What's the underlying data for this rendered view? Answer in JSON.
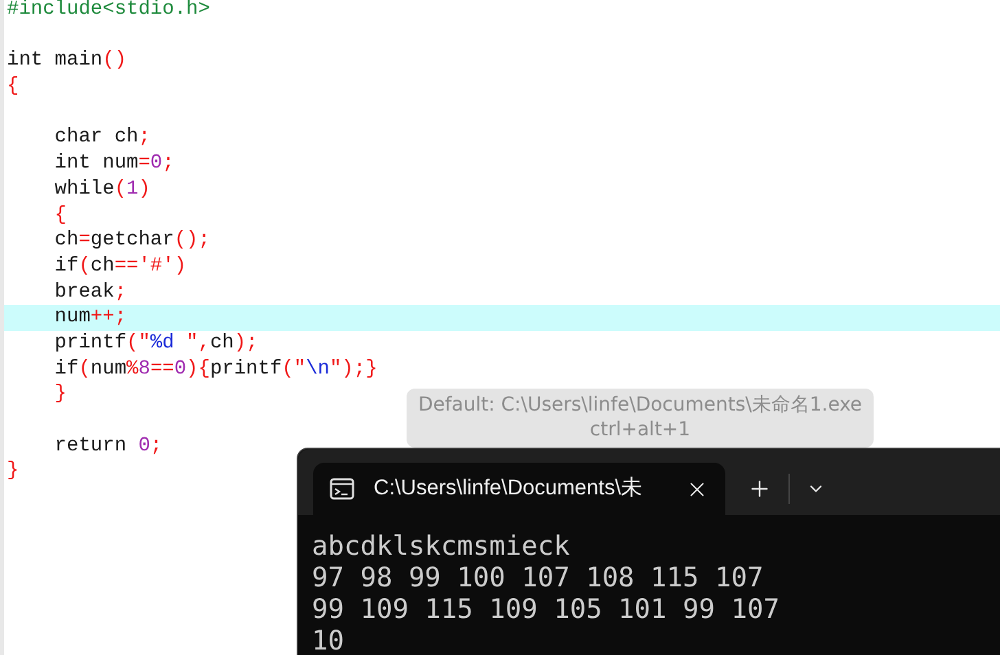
{
  "editor": {
    "lines": [
      {
        "highlighted": false,
        "tokens": [
          {
            "text": "#include<stdio.h>",
            "kind": "preproc"
          }
        ]
      },
      {
        "highlighted": false
      },
      {
        "highlighted": false,
        "tokens": [
          {
            "text": "int main",
            "kind": "plain"
          },
          {
            "text": "()",
            "kind": "punct"
          }
        ]
      },
      {
        "highlighted": false,
        "tokens": [
          {
            "text": "{",
            "kind": "punct"
          }
        ]
      },
      {
        "highlighted": false
      },
      {
        "highlighted": false,
        "tokens": [
          {
            "text": "    char ch",
            "kind": "plain"
          },
          {
            "text": ";",
            "kind": "punct"
          }
        ]
      },
      {
        "highlighted": false,
        "tokens": [
          {
            "text": "    int num",
            "kind": "plain"
          },
          {
            "text": "=",
            "kind": "punct"
          },
          {
            "text": "0",
            "kind": "number"
          },
          {
            "text": ";",
            "kind": "punct"
          }
        ]
      },
      {
        "highlighted": false,
        "tokens": [
          {
            "text": "    while",
            "kind": "plain"
          },
          {
            "text": "(",
            "kind": "punct"
          },
          {
            "text": "1",
            "kind": "number"
          },
          {
            "text": ")",
            "kind": "punct"
          }
        ]
      },
      {
        "highlighted": false,
        "tokens": [
          {
            "text": "    {",
            "kind": "punct"
          }
        ]
      },
      {
        "highlighted": false,
        "tokens": [
          {
            "text": "    ch",
            "kind": "plain"
          },
          {
            "text": "=",
            "kind": "punct"
          },
          {
            "text": "getchar",
            "kind": "plain"
          },
          {
            "text": "();",
            "kind": "punct"
          }
        ]
      },
      {
        "highlighted": false,
        "tokens": [
          {
            "text": "    if",
            "kind": "plain"
          },
          {
            "text": "(",
            "kind": "punct"
          },
          {
            "text": "ch",
            "kind": "plain"
          },
          {
            "text": "=='#')",
            "kind": "punct"
          }
        ]
      },
      {
        "highlighted": false,
        "tokens": [
          {
            "text": "    break",
            "kind": "plain"
          },
          {
            "text": ";",
            "kind": "punct"
          }
        ]
      },
      {
        "highlighted": true,
        "tokens": [
          {
            "text": "    num",
            "kind": "plain"
          },
          {
            "text": "++;",
            "kind": "punct"
          }
        ]
      },
      {
        "highlighted": false,
        "tokens": [
          {
            "text": "    printf",
            "kind": "plain"
          },
          {
            "text": "(\"",
            "kind": "punct"
          },
          {
            "text": "%d",
            "kind": "format"
          },
          {
            "text": " \",",
            "kind": "punct"
          },
          {
            "text": "ch",
            "kind": "plain"
          },
          {
            "text": ");",
            "kind": "punct"
          }
        ]
      },
      {
        "highlighted": false,
        "tokens": [
          {
            "text": "    if",
            "kind": "plain"
          },
          {
            "text": "(",
            "kind": "punct"
          },
          {
            "text": "num",
            "kind": "plain"
          },
          {
            "text": "%",
            "kind": "punct"
          },
          {
            "text": "8",
            "kind": "number"
          },
          {
            "text": "==",
            "kind": "punct"
          },
          {
            "text": "0",
            "kind": "number"
          },
          {
            "text": "){",
            "kind": "punct"
          },
          {
            "text": "printf",
            "kind": "plain"
          },
          {
            "text": "(\"",
            "kind": "punct"
          },
          {
            "text": "\\n",
            "kind": "format"
          },
          {
            "text": "\");}",
            "kind": "punct"
          }
        ]
      },
      {
        "highlighted": false,
        "tokens": [
          {
            "text": "    }",
            "kind": "punct"
          }
        ]
      },
      {
        "highlighted": false
      },
      {
        "highlighted": false,
        "tokens": [
          {
            "text": "    return ",
            "kind": "plain"
          },
          {
            "text": "0",
            "kind": "number"
          },
          {
            "text": ";",
            "kind": "punct"
          }
        ]
      },
      {
        "highlighted": false,
        "tokens": [
          {
            "text": "}",
            "kind": "punct"
          }
        ]
      }
    ]
  },
  "tooltip": {
    "lines": [
      "Default: C:\\Users\\linfe\\Documents\\未命名1.exe",
      "ctrl+alt+1"
    ]
  },
  "terminal": {
    "tab": {
      "title": "C:\\Users\\linfe\\Documents\\未",
      "selected": true
    },
    "output": [
      "abcdklskcmsmieck",
      "97 98 99 100 107 108 115 107",
      "99 109 115 109 105 101 99 107",
      "10"
    ]
  }
}
